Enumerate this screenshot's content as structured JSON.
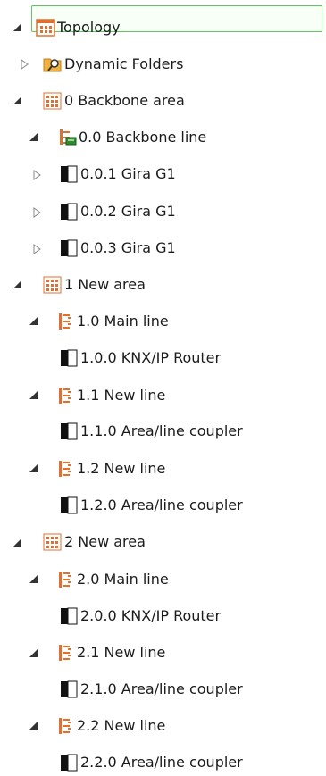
{
  "tree": {
    "topology": "Topology",
    "dynamic_folders": "Dynamic Folders",
    "area0": "0 Backbone area",
    "line00": "0.0 Backbone line",
    "dev001": "0.0.1  Gira G1",
    "dev002": "0.0.2  Gira G1",
    "dev003": "0.0.3  Gira G1",
    "area1": "1 New area",
    "line10": "1.0 Main line",
    "dev100": "1.0.0  KNX/IP Router",
    "line11": "1.1 New line",
    "dev110": "1.1.0  Area/line coupler",
    "line12": "1.2 New line",
    "dev120": "1.2.0  Area/line coupler",
    "area2": "2 New area",
    "line20": "2.0 Main line",
    "dev200": "2.0.0  KNX/IP Router",
    "line21": "2.1 New line",
    "dev210": "2.1.0  Area/line coupler",
    "line22": "2.2 New line",
    "dev220": "2.2.0  Area/line coupler"
  },
  "colors": {
    "selection_border": "#62c462",
    "area_icon": "#e07030",
    "line_icon": "#e07030",
    "device_icon": "#111111"
  }
}
